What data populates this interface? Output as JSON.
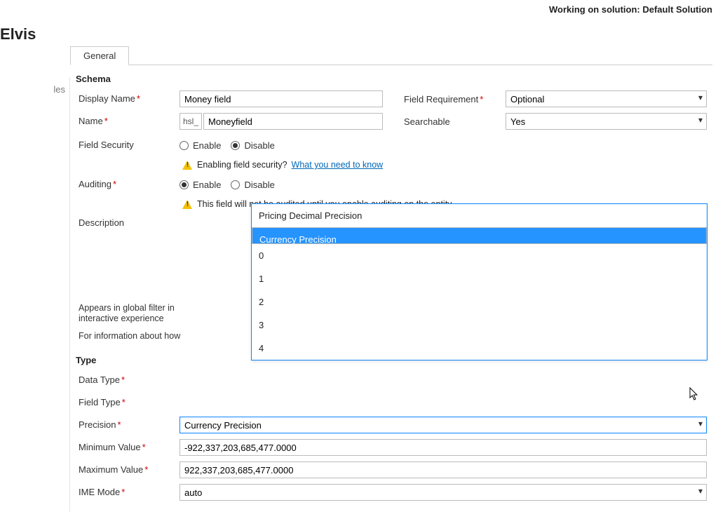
{
  "topbar": {
    "working_on": "Working on solution: Default Solution"
  },
  "page_title": "Elvis",
  "sidebar": {
    "item0": "les"
  },
  "tabs": {
    "general": "General"
  },
  "sections": {
    "schema": "Schema",
    "type": "Type"
  },
  "labels": {
    "display_name": "Display Name",
    "name": "Name",
    "field_security": "Field Security",
    "auditing": "Auditing",
    "description": "Description",
    "field_requirement": "Field Requirement",
    "searchable": "Searchable",
    "appears_in_filter": "Appears in global filter in interactive experience",
    "for_info": "For information about how",
    "data_type": "Data Type",
    "field_type": "Field Type",
    "precision": "Precision",
    "min_value": "Minimum Value",
    "max_value": "Maximum Value",
    "ime_mode": "IME Mode"
  },
  "values": {
    "display_name": "Money field",
    "name_prefix": "hsl_",
    "name": "Moneyfield",
    "field_requirement": "Optional",
    "searchable": "Yes",
    "precision_selected": "Currency Precision",
    "min_value": "-922,337,203,685,477.0000",
    "max_value": "922,337,203,685,477.0000",
    "ime_mode": "auto"
  },
  "radios": {
    "enable": "Enable",
    "disable": "Disable"
  },
  "warnings": {
    "field_security_q": "Enabling field security?",
    "field_security_link": "What you need to know",
    "auditing_note": "This field will not be audited until you enable auditing on the entity."
  },
  "precision_options": [
    "Pricing Decimal Precision",
    "Currency Precision",
    "0",
    "1",
    "2",
    "3",
    "4"
  ]
}
